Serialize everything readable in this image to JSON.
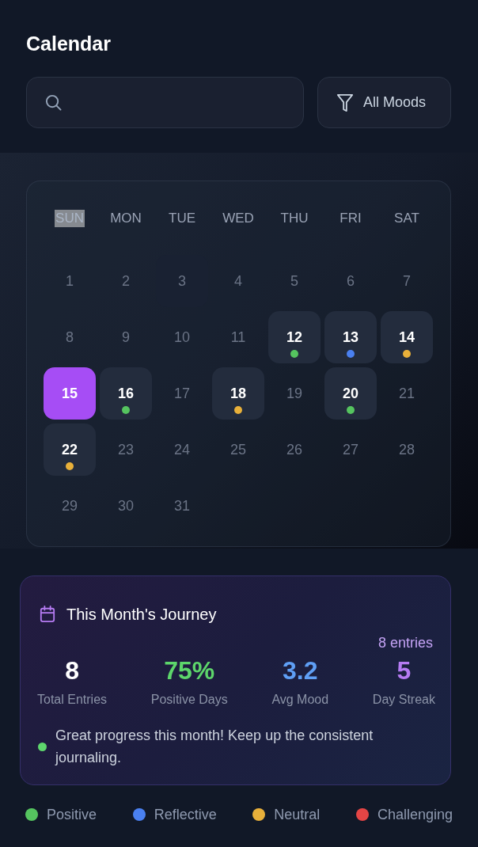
{
  "header": {
    "title": "Calendar",
    "filter_button": {
      "label": "All Moods"
    }
  },
  "calendar": {
    "weekdays": [
      {
        "label": "SUN",
        "highlighted": true
      },
      {
        "label": "MON",
        "highlighted": false
      },
      {
        "label": "TUE",
        "highlighted": false
      },
      {
        "label": "WED",
        "highlighted": false
      },
      {
        "label": "THU",
        "highlighted": false
      },
      {
        "label": "FRI",
        "highlighted": false
      },
      {
        "label": "SAT",
        "highlighted": false
      }
    ],
    "days": [
      {
        "label": "1",
        "selected": false,
        "hovered": false,
        "has_entry": false
      },
      {
        "label": "2",
        "selected": false,
        "hovered": false,
        "has_entry": false
      },
      {
        "label": "3",
        "selected": false,
        "hovered": true,
        "has_entry": false
      },
      {
        "label": "4",
        "selected": false,
        "hovered": false,
        "has_entry": false
      },
      {
        "label": "5",
        "selected": false,
        "hovered": false,
        "has_entry": false
      },
      {
        "label": "6",
        "selected": false,
        "hovered": false,
        "has_entry": false
      },
      {
        "label": "7",
        "selected": false,
        "hovered": false,
        "has_entry": false
      },
      {
        "label": "8",
        "selected": false,
        "hovered": false,
        "has_entry": false
      },
      {
        "label": "9",
        "selected": false,
        "hovered": false,
        "has_entry": false
      },
      {
        "label": "10",
        "selected": false,
        "hovered": false,
        "has_entry": false
      },
      {
        "label": "11",
        "selected": false,
        "hovered": false,
        "has_entry": false
      },
      {
        "label": "12",
        "selected": false,
        "hovered": false,
        "has_entry": true,
        "color": "#55c45f"
      },
      {
        "label": "13",
        "selected": false,
        "hovered": false,
        "has_entry": true,
        "color": "#4a80f0"
      },
      {
        "label": "14",
        "selected": false,
        "hovered": false,
        "has_entry": true,
        "color": "#e8b03a"
      },
      {
        "label": "15",
        "selected": true,
        "hovered": false,
        "has_entry": false
      },
      {
        "label": "16",
        "selected": false,
        "hovered": false,
        "has_entry": true,
        "color": "#55c45f"
      },
      {
        "label": "17",
        "selected": false,
        "hovered": false,
        "has_entry": false
      },
      {
        "label": "18",
        "selected": false,
        "hovered": false,
        "has_entry": true,
        "color": "#e8b03a"
      },
      {
        "label": "19",
        "selected": false,
        "hovered": false,
        "has_entry": false
      },
      {
        "label": "20",
        "selected": false,
        "hovered": false,
        "has_entry": true,
        "color": "#55c45f"
      },
      {
        "label": "21",
        "selected": false,
        "hovered": false,
        "has_entry": false
      },
      {
        "label": "22",
        "selected": false,
        "hovered": false,
        "has_entry": true,
        "color": "#e8b03a"
      },
      {
        "label": "23",
        "selected": false,
        "hovered": false,
        "has_entry": false
      },
      {
        "label": "24",
        "selected": false,
        "hovered": false,
        "has_entry": false
      },
      {
        "label": "25",
        "selected": false,
        "hovered": false,
        "has_entry": false
      },
      {
        "label": "26",
        "selected": false,
        "hovered": false,
        "has_entry": false
      },
      {
        "label": "27",
        "selected": false,
        "hovered": false,
        "has_entry": false
      },
      {
        "label": "28",
        "selected": false,
        "hovered": false,
        "has_entry": false
      },
      {
        "label": "29",
        "selected": false,
        "hovered": false,
        "has_entry": false
      },
      {
        "label": "30",
        "selected": false,
        "hovered": false,
        "has_entry": false
      },
      {
        "label": "31",
        "selected": false,
        "hovered": false,
        "has_entry": false
      }
    ]
  },
  "journey": {
    "title": "This Month's Journey",
    "entries": "8 entries",
    "stats": [
      {
        "value": "8",
        "label": "Total Entries",
        "color": "#ffffff"
      },
      {
        "value": "75%",
        "label": "Positive Days",
        "color": "#5dd66b"
      },
      {
        "value": "3.2",
        "label": "Avg Mood",
        "color": "#5f9ff5"
      },
      {
        "value": "5",
        "label": "Day Streak",
        "color": "#b57bf2"
      }
    ],
    "message": "Great progress this month! Keep up the consistent journaling."
  },
  "legend": [
    {
      "label": "Positive",
      "color": "#55c45f"
    },
    {
      "label": "Reflective",
      "color": "#4a80f0"
    },
    {
      "label": "Neutral",
      "color": "#e8b03a"
    },
    {
      "label": "Challenging",
      "color": "#e44545"
    }
  ]
}
